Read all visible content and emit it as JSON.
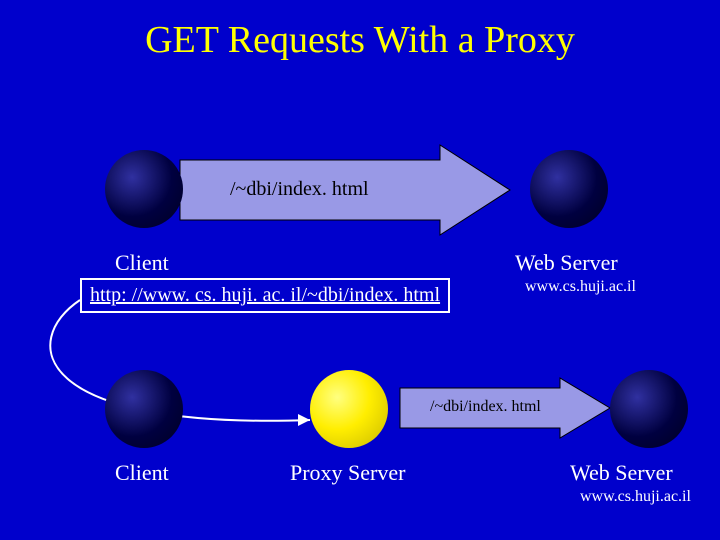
{
  "title": "GET Requests With a Proxy",
  "top": {
    "client_label": "Client",
    "server_label": "Web Server",
    "server_host": "www.cs.huji.ac.il",
    "arrow_text": "/~dbi/index. html",
    "url_box": "http: //www. cs. huji. ac. il/~dbi/index. html"
  },
  "bottom": {
    "client_label": "Client",
    "proxy_label": "Proxy Server",
    "server_label": "Web Server",
    "server_host": "www.cs.huji.ac.il",
    "arrow_text": "/~dbi/index. html"
  }
}
